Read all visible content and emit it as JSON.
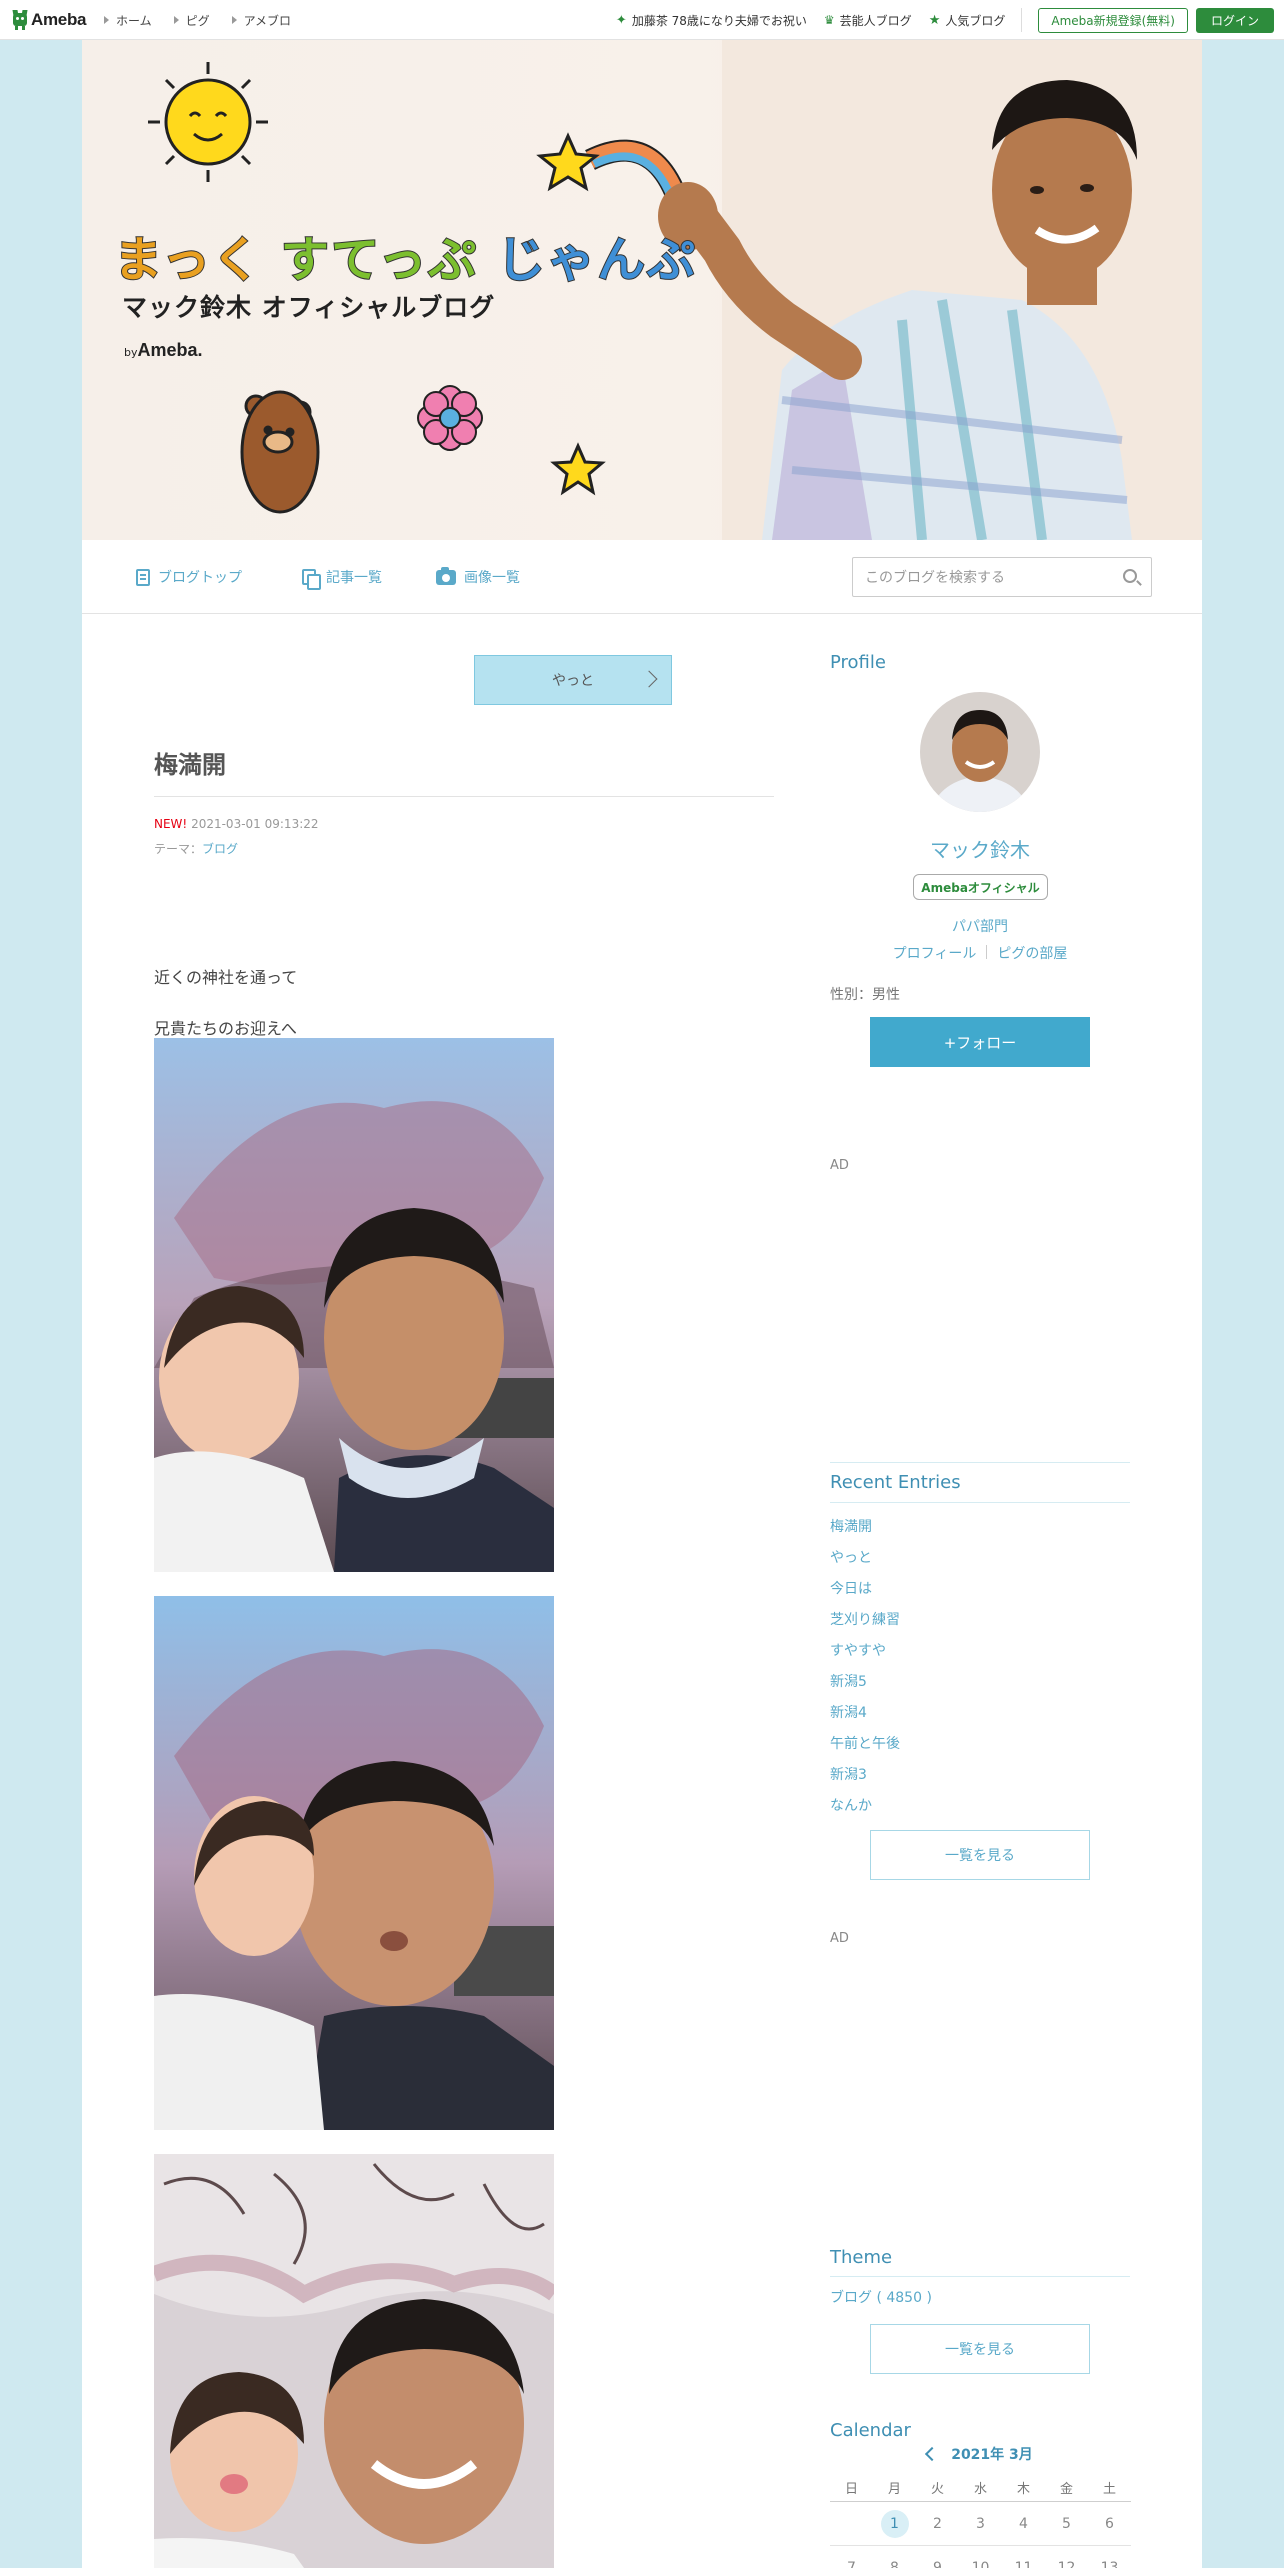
{
  "topbar": {
    "logo": "Ameba",
    "nav": [
      "ホーム",
      "ピグ",
      "アメブロ"
    ],
    "links": [
      {
        "label": "加藤茶 78歳になり夫婦でお祝い",
        "icon": "star-icon"
      },
      {
        "label": "芸能人ブログ",
        "icon": "crown-icon"
      },
      {
        "label": "人気ブログ",
        "icon": "star-icon"
      }
    ],
    "register": "Ameba新規登録(無料)",
    "login": "ログイン"
  },
  "header": {
    "title_parts": [
      "まっく",
      "すてっぷ",
      "じゃんぷ"
    ],
    "subtitle": "マック鈴木 オフィシャルブログ",
    "by": "by",
    "brand": "Ameba."
  },
  "blognav": {
    "items": [
      "ブログトップ",
      "記事一覧",
      "画像一覧"
    ],
    "search_placeholder": "このブログを検索する"
  },
  "article": {
    "prev_label": "やっと",
    "title": "梅満開",
    "new_badge": "NEW!",
    "datetime": "2021-03-01 09:13:22",
    "theme_label": "テーマ：",
    "theme": "ブログ",
    "lines": [
      "近くの神社を通って",
      "兄貴たちのお迎えへ"
    ]
  },
  "sidebar": {
    "profile_heading": "Profile",
    "name": "マック鈴木",
    "badge": "Amebaオフィシャル",
    "category": "パパ部門",
    "links": [
      "プロフィール",
      "ピグの部屋"
    ],
    "gender": "性別：男性",
    "follow": "+フォロー",
    "ad": "AD",
    "recent_heading": "Recent Entries",
    "recent": [
      "梅満開",
      "やっと",
      "今日は",
      "芝刈り練習",
      "すやすや",
      "新潟5",
      "新潟4",
      "午前と午後",
      "新潟3",
      "なんか"
    ],
    "see_all": "一覧を見る",
    "theme_heading": "Theme",
    "theme_item": "ブログ ( 4850 )",
    "calendar_heading": "Calendar",
    "calendar_month": "2021年 3月",
    "weekdays": [
      "日",
      "月",
      "火",
      "水",
      "木",
      "金",
      "土"
    ],
    "weeks": [
      [
        "",
        "1",
        "2",
        "3",
        "4",
        "5",
        "6"
      ],
      [
        "7",
        "8",
        "9",
        "10",
        "11",
        "12",
        "13"
      ]
    ]
  },
  "colors": {
    "accent": "#41a9cd",
    "link": "#5aa9c9",
    "ameba_green": "#2d8c3c",
    "background": "#cfe9f0",
    "new_red": "#e60012"
  }
}
